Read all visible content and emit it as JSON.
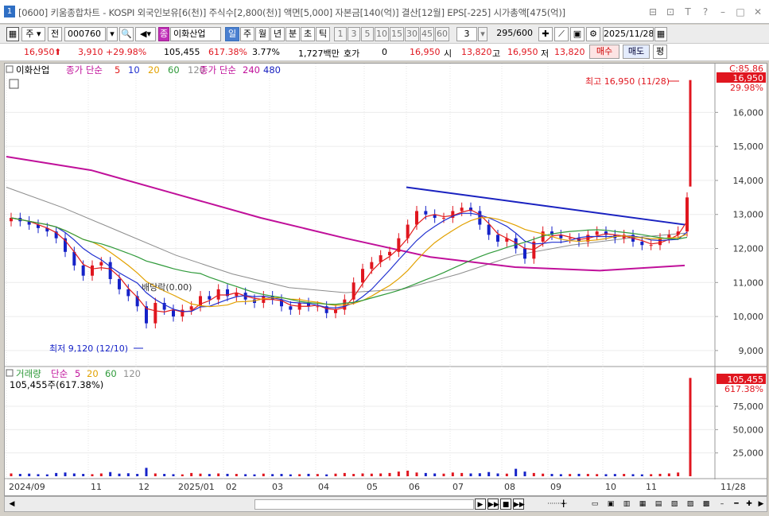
{
  "window": {
    "number": "1",
    "title": "[0600] 키움종합차트 - KOSPI 외국인보유[6(천)] 주식수[2,800(천)] 액면[5,000] 자본금[140(억)] 결산[12월] EPS[-225] 시가총액[475(억)]",
    "buttons": [
      "⊟",
      "⊡",
      "T",
      "?",
      "–",
      "□",
      "✕"
    ]
  },
  "toolbar": {
    "type_select": "주",
    "all_btn": "전",
    "code": "000760",
    "stock_badge": "종",
    "stock_name": "이화산업",
    "periods": [
      "일",
      "주",
      "월",
      "년",
      "분",
      "초",
      "틱"
    ],
    "active_period": "일",
    "intervals": [
      "1",
      "3",
      "5",
      "10",
      "15",
      "30",
      "45",
      "60"
    ],
    "interval_value": "3",
    "count": "295",
    "count_max": "/600",
    "date": "2025/11/28"
  },
  "info": {
    "price": "16,950",
    "change": "3,910",
    "change_pct": "+29.98%",
    "volume": "105,455",
    "volume_pct": "617.38%",
    "turnover": "3.77%",
    "amount": "1,727백만",
    "hoga_label": "호가",
    "hoga_value": "0",
    "close": "16,950",
    "open_label": "시",
    "open": "13,820",
    "high_label": "고",
    "high": "16,950",
    "low_label": "저",
    "low": "13,820",
    "buy": "매수",
    "sell": "매도",
    "eval": "평"
  },
  "price_legend": {
    "name": "이화산업",
    "ma_label": "종가 단순",
    "mas": [
      "5",
      "10",
      "20",
      "60",
      "120"
    ],
    "ma2_label": "종가 단순",
    "ma2s": [
      "240",
      "480"
    ],
    "ma_colors": [
      "#e21b1b",
      "#2030d0",
      "#e2a100",
      "#2f9a3a",
      "#909090",
      "#c0109a",
      "#1a22c0"
    ]
  },
  "volume_legend": {
    "label": "거래량",
    "ma_label": "단순",
    "mas": [
      "5",
      "20",
      "60",
      "120"
    ],
    "current": "105,455주(617.38%)"
  },
  "annotations": {
    "high": "최고 16,950 (11/28)",
    "low": "최저 9,120 (12/10)",
    "dividend": "배당락(0.00)"
  },
  "right_labels": {
    "top_value": "C:85.86",
    "current_price": "16,950",
    "current_pct": "29.98%",
    "volume_value": "105,455",
    "volume_pct": "617.38%",
    "last_date": "11/28"
  },
  "chart_data": {
    "type": "candlestick",
    "x_labels": [
      "2024/09",
      "11",
      "12",
      "2025/01",
      "02",
      "03",
      "04",
      "05",
      "06",
      "07",
      "08",
      "09",
      "10",
      "11"
    ],
    "price_axis": [
      "16,000",
      "15,000",
      "14,000",
      "13,000",
      "12,000",
      "11,000",
      "10,000",
      "9,000"
    ],
    "price_ticks": [
      16000,
      15000,
      14000,
      13000,
      12000,
      11000,
      10000,
      9000
    ],
    "volume_axis": [
      "75,000",
      "50,000",
      "25,000"
    ],
    "volume_ticks": [
      75000,
      50000,
      25000
    ],
    "price_range": [
      8600,
      17200
    ],
    "volume_range": [
      0,
      110000
    ],
    "series_close": [
      12900,
      12800,
      12700,
      12600,
      12500,
      12300,
      11900,
      11500,
      11200,
      11500,
      11600,
      11100,
      10800,
      10600,
      10300,
      9800,
      10400,
      10200,
      10000,
      10200,
      10300,
      10600,
      10500,
      10800,
      10600,
      10700,
      10500,
      10400,
      10600,
      10500,
      10300,
      10200,
      10400,
      10300,
      10300,
      10100,
      10200,
      10500,
      11000,
      11400,
      11600,
      11800,
      11900,
      12300,
      12700,
      13100,
      13000,
      12900,
      12900,
      13100,
      13200,
      13100,
      12700,
      12400,
      12200,
      12300,
      12000,
      11700,
      12200,
      12500,
      12400,
      12300,
      12300,
      12200,
      12400,
      12500,
      12400,
      12300,
      12400,
      12200,
      12100,
      12100,
      12300,
      12400,
      12500,
      13500
    ],
    "volume": [
      3000,
      2500,
      2800,
      2200,
      2000,
      3500,
      4000,
      3000,
      2500,
      2200,
      3000,
      4500,
      2800,
      3200,
      2500,
      9000,
      3000,
      2500,
      2200,
      2000,
      3500,
      2800,
      2400,
      3000,
      2600,
      2500,
      2200,
      2000,
      2800,
      2300,
      2500,
      2000,
      2200,
      2600,
      2400,
      2000,
      2800,
      3500,
      2500,
      3000,
      2800,
      3000,
      3500,
      5000,
      6000,
      4000,
      3500,
      3000,
      2800,
      4000,
      3500,
      3000,
      3200,
      4500,
      3000,
      2800,
      8000,
      5000,
      3500,
      2800,
      2500,
      2200,
      2400,
      2600,
      2500,
      2300,
      2200,
      2400,
      2500,
      2200,
      2000,
      2200,
      2600,
      3000,
      4000,
      105455
    ],
    "trendline": [
      [
        13800,
        12700
      ]
    ],
    "ma240": [
      14700,
      14300,
      13600,
      12900,
      12300,
      11750,
      11450,
      11350,
      11500
    ],
    "ma120": [
      13800,
      13200,
      12500,
      11800,
      11250,
      10850,
      10700,
      10800,
      11250,
      11800,
      12100,
      12300,
      12450
    ]
  }
}
